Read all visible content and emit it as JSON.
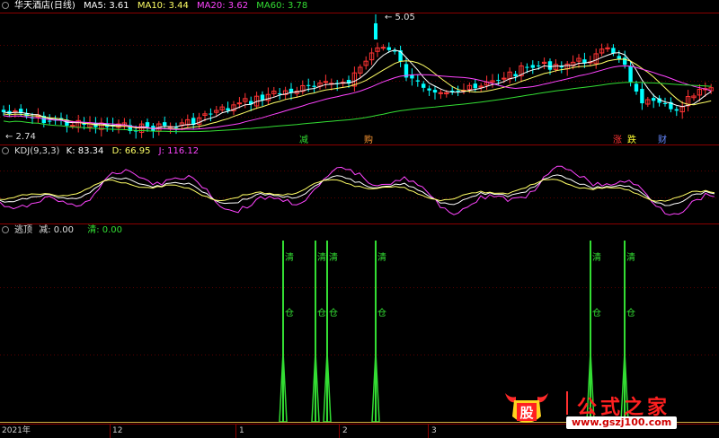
{
  "main_panel": {
    "stock_name": "华天酒店(日线)",
    "ma": [
      {
        "label": "MA5:",
        "value": "3.61",
        "color": "#ffffff"
      },
      {
        "label": "MA10:",
        "value": "3.44",
        "color": "#ffff66"
      },
      {
        "label": "MA20:",
        "value": "3.62",
        "color": "#ff44ff"
      },
      {
        "label": "MA60:",
        "value": "3.78",
        "color": "#33dd33"
      }
    ],
    "high_label": "5.05",
    "low_label": "2.74",
    "markers": [
      "减",
      "购",
      "涨",
      "跌",
      "财"
    ]
  },
  "kdj_panel": {
    "title": "KDJ(9,3,3)",
    "k": "K: 83.34",
    "d": "D: 66.95",
    "j": "J: 116.12"
  },
  "signal_panel": {
    "title": "逃顶",
    "jian": "减: 0.00",
    "qing": "清: 0.00",
    "signal_top": "清",
    "signal_bottom": "仓"
  },
  "time_axis": [
    "2021年",
    "12",
    "1",
    "2",
    "3"
  ],
  "watermark": {
    "title": "公式之家",
    "url": "www.gszj100.com"
  },
  "colors": {
    "up": "#ff3333",
    "down": "#00ffff",
    "signal": "#33dd33",
    "grid": "#8b0000"
  }
}
